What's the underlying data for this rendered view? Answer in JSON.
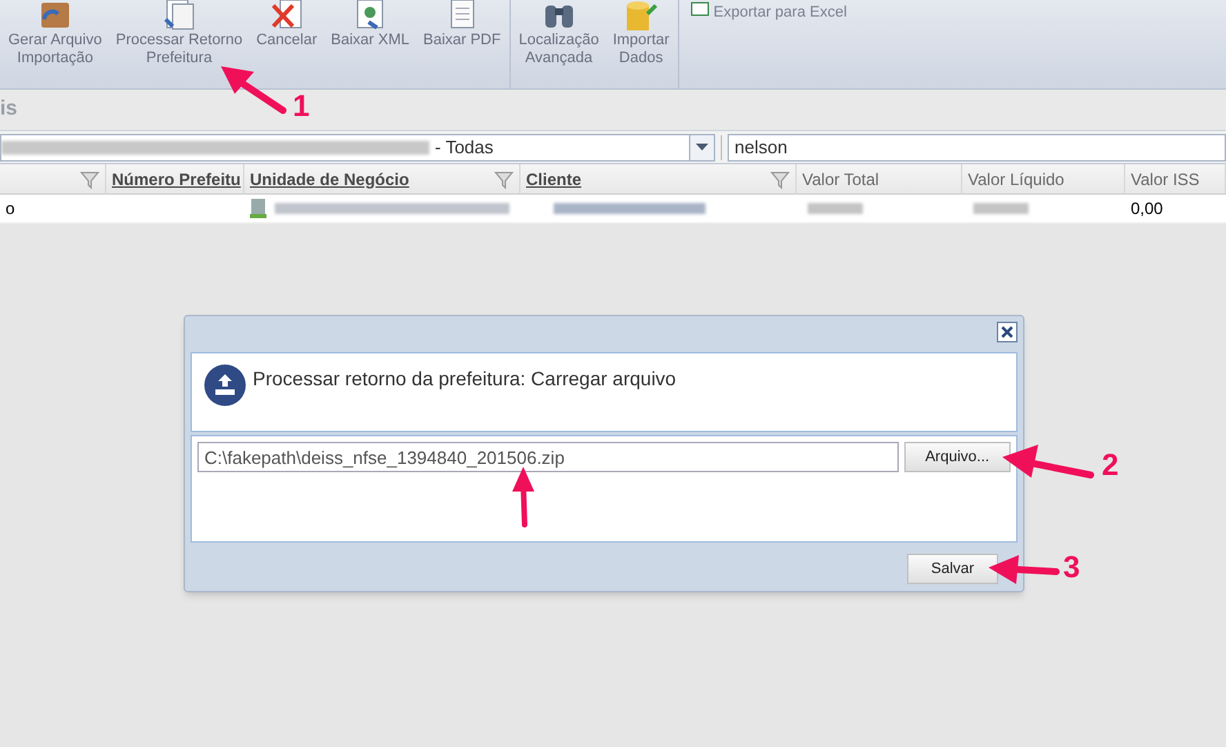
{
  "toolbar": {
    "groups": [
      {
        "buttons": [
          {
            "kind": "box",
            "lines": [
              "Gerar Arquivo",
              "Importação"
            ]
          },
          {
            "kind": "doc",
            "lines": [
              "Processar Retorno",
              "Prefeitura"
            ]
          },
          {
            "kind": "cancel",
            "lines": [
              "Cancelar"
            ]
          },
          {
            "kind": "xml",
            "lines": [
              "Baixar XML"
            ]
          },
          {
            "kind": "pdf",
            "lines": [
              "Baixar PDF"
            ]
          }
        ]
      },
      {
        "buttons": [
          {
            "kind": "binoculars",
            "lines": [
              "Localização",
              "Avançada"
            ]
          },
          {
            "kind": "database",
            "lines": [
              "Importar",
              "Dados"
            ]
          }
        ]
      },
      {
        "buttons": [
          {
            "kind": "excel",
            "lines": [
              "Exportar para Excel"
            ]
          }
        ]
      }
    ]
  },
  "section_title": "is",
  "filters": {
    "company_suffix": "- Todas",
    "search": "nelson"
  },
  "table": {
    "columns": [
      {
        "filter": true,
        "link": false
      },
      {
        "label": "Número Prefeitu",
        "filter": false,
        "link": true
      },
      {
        "label": "Unidade de Negócio",
        "filter": true,
        "link": true
      },
      {
        "label": "Cliente",
        "filter": true,
        "link": true
      },
      {
        "label": "Valor Total",
        "filter": false,
        "link": false
      },
      {
        "label": "Valor Líquido",
        "filter": false,
        "link": false
      },
      {
        "label": "Valor ISS",
        "filter": false,
        "link": false
      }
    ],
    "rows": [
      [
        "o",
        "",
        "",
        "",
        "",
        "",
        "0,00"
      ]
    ]
  },
  "dialog": {
    "title": "Processar retorno da prefeitura: Carregar arquivo",
    "file": "C:\\fakepath\\deiss_nfse_1394840_201506.zip",
    "browse_label": "Arquivo...",
    "save_label": "Salvar"
  },
  "annotations": [
    "1",
    "2",
    "3"
  ]
}
